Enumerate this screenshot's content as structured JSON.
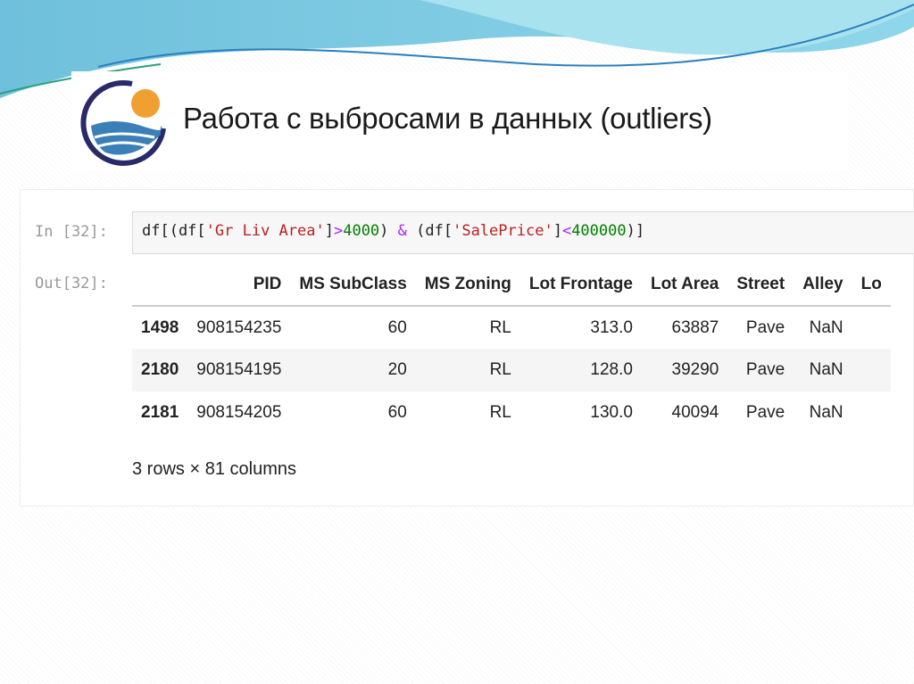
{
  "slide": {
    "title": "Работа с выбросами в данных (outliers)"
  },
  "cell": {
    "in_prompt": "In [32]:",
    "out_prompt": "Out[32]:",
    "code": {
      "p1": "df[(df[",
      "s1": "'Gr Liv Area'",
      "p2": "]",
      ">": ">",
      "n1": "4000",
      "p3": ") ",
      "amp": "&",
      "p4": " (df[",
      "s2": "'SalePrice'",
      "p5": "]",
      "lt": "<",
      "n2": "400000",
      "p6": ")]"
    },
    "table": {
      "columns": [
        "",
        "PID",
        "MS SubClass",
        "MS Zoning",
        "Lot Frontage",
        "Lot Area",
        "Street",
        "Alley",
        "Lo"
      ],
      "rows": [
        [
          "1498",
          "908154235",
          "60",
          "RL",
          "313.0",
          "63887",
          "Pave",
          "NaN",
          ""
        ],
        [
          "2180",
          "908154195",
          "20",
          "RL",
          "128.0",
          "39290",
          "Pave",
          "NaN",
          ""
        ],
        [
          "2181",
          "908154205",
          "60",
          "RL",
          "130.0",
          "40094",
          "Pave",
          "NaN",
          ""
        ]
      ]
    },
    "footer": "3 rows × 81 columns"
  }
}
